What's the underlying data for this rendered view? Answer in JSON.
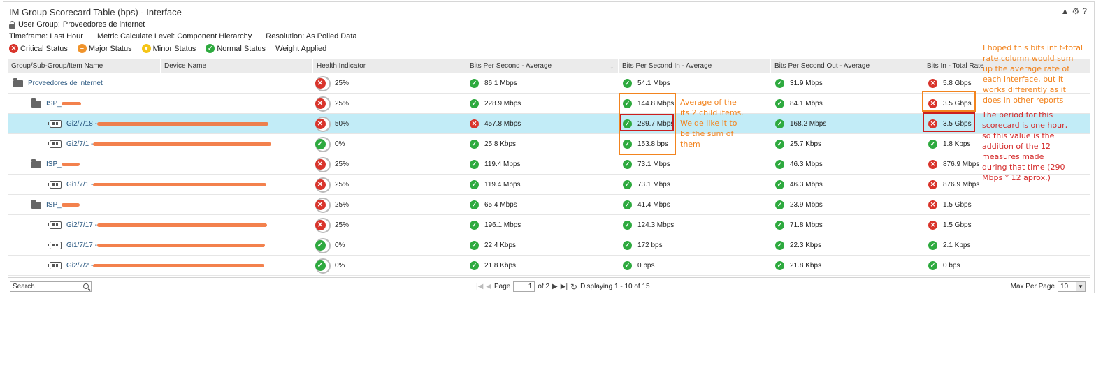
{
  "header": {
    "title": "IM Group Scorecard Table (bps) - Interface",
    "icons": {
      "collapse": "▲",
      "settings": "⚙",
      "help": "?"
    }
  },
  "user_group": {
    "label": "User Group:",
    "value": "Proveedores de internet"
  },
  "meta": {
    "timeframe": "Timeframe: Last Hour",
    "metric_level": "Metric Calculate Level: Component Hierarchy",
    "resolution": "Resolution: As Polled Data"
  },
  "legend": {
    "critical": "Critical Status",
    "major": "Major Status",
    "minor": "Minor Status",
    "normal": "Normal Status",
    "weight": "Weight Applied"
  },
  "columns": {
    "name": "Group/Sub-Group/Item Name",
    "device": "Device Name",
    "health": "Health Indicator",
    "bps_avg": "Bits Per Second - Average",
    "bps_in": "Bits Per Second In - Average",
    "bps_out": "Bits Per Second Out - Average",
    "bits_in_total": "Bits In - Total Rate"
  },
  "rows": [
    {
      "name": "Proveedores de internet",
      "health": "25%",
      "bps": "86.1 Mbps",
      "in": "54.1 Mbps",
      "out": "31.9 Mbps",
      "total": "5.8 Gbps"
    },
    {
      "name": "ISP_",
      "health": "25%",
      "bps": "228.9 Mbps",
      "in": "144.8 Mbps",
      "out": "84.1 Mbps",
      "total": "3.5 Gbps"
    },
    {
      "name": "Gi2/7/18 - ",
      "health": "50%",
      "bps": "457.8 Mbps",
      "in": "289.7 Mbps",
      "out": "168.2 Mbps",
      "total": "3.5 Gbps"
    },
    {
      "name": "Gi2/7/1 - ",
      "health": "0%",
      "bps": "25.8 Kbps",
      "in": "153.8 bps",
      "out": "25.7 Kbps",
      "total": "1.8 Kbps"
    },
    {
      "name": "ISP_",
      "health": "25%",
      "bps": "119.4 Mbps",
      "in": "73.1 Mbps",
      "out": "46.3 Mbps",
      "total": "876.9 Mbps"
    },
    {
      "name": "Gi1/7/1 - ",
      "health": "25%",
      "bps": "119.4 Mbps",
      "in": "73.1 Mbps",
      "out": "46.3 Mbps",
      "total": "876.9 Mbps"
    },
    {
      "name": "ISP_",
      "health": "25%",
      "bps": "65.4 Mbps",
      "in": "41.4 Mbps",
      "out": "23.9 Mbps",
      "total": "1.5 Gbps"
    },
    {
      "name": "Gi2/7/17 - ",
      "health": "25%",
      "bps": "196.1 Mbps",
      "in": "124.3 Mbps",
      "out": "71.8 Mbps",
      "total": "1.5 Gbps"
    },
    {
      "name": "Gi1/7/17 - ",
      "health": "0%",
      "bps": "22.4 Kbps",
      "in": "172 bps",
      "out": "22.3 Kbps",
      "total": "2.1 Kbps"
    },
    {
      "name": "Gi2/7/2 - ",
      "health": "0%",
      "bps": "21.8 Kbps",
      "in": "0 bps",
      "out": "21.8 Kbps",
      "total": "0 bps"
    }
  ],
  "footer": {
    "search_placeholder": "Search",
    "page_label": "Page",
    "page_value": "1",
    "of_label": "of 2",
    "displaying": "Displaying 1 - 10 of 15",
    "max_per_page_label": "Max Per Page",
    "max_per_page_value": "10"
  },
  "annotations": {
    "avg_note": "Average of the its 2 child items. We'de like it to be the sum of them",
    "total_note": "I hoped this bits int t-total rate column would sum up the average rate of each interface, but it works differently as it does in other reports",
    "period_note": "The period for this scorecard is one hour, so this value is the addition of the 12 measures made during that time (290 Mbps * 12 aprox.)"
  },
  "colors": {
    "critical": "#d9342b",
    "major": "#f0932b",
    "minor": "#f5c518",
    "normal": "#2eaa3f",
    "selected_row": "#c2ecf7",
    "note_orange": "#f2841f",
    "note_red": "#d42a2a"
  }
}
